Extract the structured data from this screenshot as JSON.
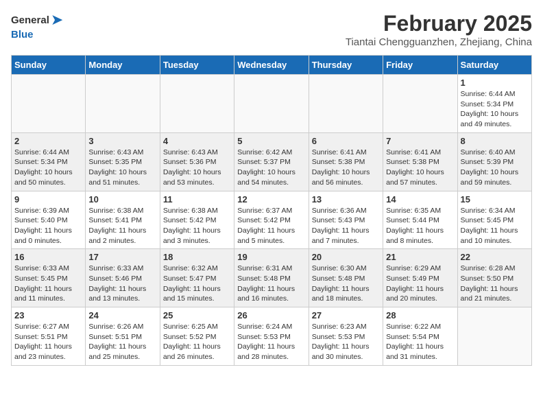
{
  "header": {
    "logo_general": "General",
    "logo_blue": "Blue",
    "main_title": "February 2025",
    "subtitle": "Tiantai Chengguanzhen, Zhejiang, China"
  },
  "calendar": {
    "days_of_week": [
      "Sunday",
      "Monday",
      "Tuesday",
      "Wednesday",
      "Thursday",
      "Friday",
      "Saturday"
    ],
    "weeks": [
      {
        "bg": "light",
        "days": [
          {
            "num": "",
            "info": ""
          },
          {
            "num": "",
            "info": ""
          },
          {
            "num": "",
            "info": ""
          },
          {
            "num": "",
            "info": ""
          },
          {
            "num": "",
            "info": ""
          },
          {
            "num": "",
            "info": ""
          },
          {
            "num": "1",
            "info": "Sunrise: 6:44 AM\nSunset: 5:34 PM\nDaylight: 10 hours\nand 49 minutes."
          }
        ]
      },
      {
        "bg": "gray",
        "days": [
          {
            "num": "2",
            "info": "Sunrise: 6:44 AM\nSunset: 5:34 PM\nDaylight: 10 hours\nand 50 minutes."
          },
          {
            "num": "3",
            "info": "Sunrise: 6:43 AM\nSunset: 5:35 PM\nDaylight: 10 hours\nand 51 minutes."
          },
          {
            "num": "4",
            "info": "Sunrise: 6:43 AM\nSunset: 5:36 PM\nDaylight: 10 hours\nand 53 minutes."
          },
          {
            "num": "5",
            "info": "Sunrise: 6:42 AM\nSunset: 5:37 PM\nDaylight: 10 hours\nand 54 minutes."
          },
          {
            "num": "6",
            "info": "Sunrise: 6:41 AM\nSunset: 5:38 PM\nDaylight: 10 hours\nand 56 minutes."
          },
          {
            "num": "7",
            "info": "Sunrise: 6:41 AM\nSunset: 5:38 PM\nDaylight: 10 hours\nand 57 minutes."
          },
          {
            "num": "8",
            "info": "Sunrise: 6:40 AM\nSunset: 5:39 PM\nDaylight: 10 hours\nand 59 minutes."
          }
        ]
      },
      {
        "bg": "light",
        "days": [
          {
            "num": "9",
            "info": "Sunrise: 6:39 AM\nSunset: 5:40 PM\nDaylight: 11 hours\nand 0 minutes."
          },
          {
            "num": "10",
            "info": "Sunrise: 6:38 AM\nSunset: 5:41 PM\nDaylight: 11 hours\nand 2 minutes."
          },
          {
            "num": "11",
            "info": "Sunrise: 6:38 AM\nSunset: 5:42 PM\nDaylight: 11 hours\nand 3 minutes."
          },
          {
            "num": "12",
            "info": "Sunrise: 6:37 AM\nSunset: 5:42 PM\nDaylight: 11 hours\nand 5 minutes."
          },
          {
            "num": "13",
            "info": "Sunrise: 6:36 AM\nSunset: 5:43 PM\nDaylight: 11 hours\nand 7 minutes."
          },
          {
            "num": "14",
            "info": "Sunrise: 6:35 AM\nSunset: 5:44 PM\nDaylight: 11 hours\nand 8 minutes."
          },
          {
            "num": "15",
            "info": "Sunrise: 6:34 AM\nSunset: 5:45 PM\nDaylight: 11 hours\nand 10 minutes."
          }
        ]
      },
      {
        "bg": "gray",
        "days": [
          {
            "num": "16",
            "info": "Sunrise: 6:33 AM\nSunset: 5:45 PM\nDaylight: 11 hours\nand 11 minutes."
          },
          {
            "num": "17",
            "info": "Sunrise: 6:33 AM\nSunset: 5:46 PM\nDaylight: 11 hours\nand 13 minutes."
          },
          {
            "num": "18",
            "info": "Sunrise: 6:32 AM\nSunset: 5:47 PM\nDaylight: 11 hours\nand 15 minutes."
          },
          {
            "num": "19",
            "info": "Sunrise: 6:31 AM\nSunset: 5:48 PM\nDaylight: 11 hours\nand 16 minutes."
          },
          {
            "num": "20",
            "info": "Sunrise: 6:30 AM\nSunset: 5:48 PM\nDaylight: 11 hours\nand 18 minutes."
          },
          {
            "num": "21",
            "info": "Sunrise: 6:29 AM\nSunset: 5:49 PM\nDaylight: 11 hours\nand 20 minutes."
          },
          {
            "num": "22",
            "info": "Sunrise: 6:28 AM\nSunset: 5:50 PM\nDaylight: 11 hours\nand 21 minutes."
          }
        ]
      },
      {
        "bg": "light",
        "days": [
          {
            "num": "23",
            "info": "Sunrise: 6:27 AM\nSunset: 5:51 PM\nDaylight: 11 hours\nand 23 minutes."
          },
          {
            "num": "24",
            "info": "Sunrise: 6:26 AM\nSunset: 5:51 PM\nDaylight: 11 hours\nand 25 minutes."
          },
          {
            "num": "25",
            "info": "Sunrise: 6:25 AM\nSunset: 5:52 PM\nDaylight: 11 hours\nand 26 minutes."
          },
          {
            "num": "26",
            "info": "Sunrise: 6:24 AM\nSunset: 5:53 PM\nDaylight: 11 hours\nand 28 minutes."
          },
          {
            "num": "27",
            "info": "Sunrise: 6:23 AM\nSunset: 5:53 PM\nDaylight: 11 hours\nand 30 minutes."
          },
          {
            "num": "28",
            "info": "Sunrise: 6:22 AM\nSunset: 5:54 PM\nDaylight: 11 hours\nand 31 minutes."
          },
          {
            "num": "",
            "info": ""
          }
        ]
      }
    ]
  }
}
